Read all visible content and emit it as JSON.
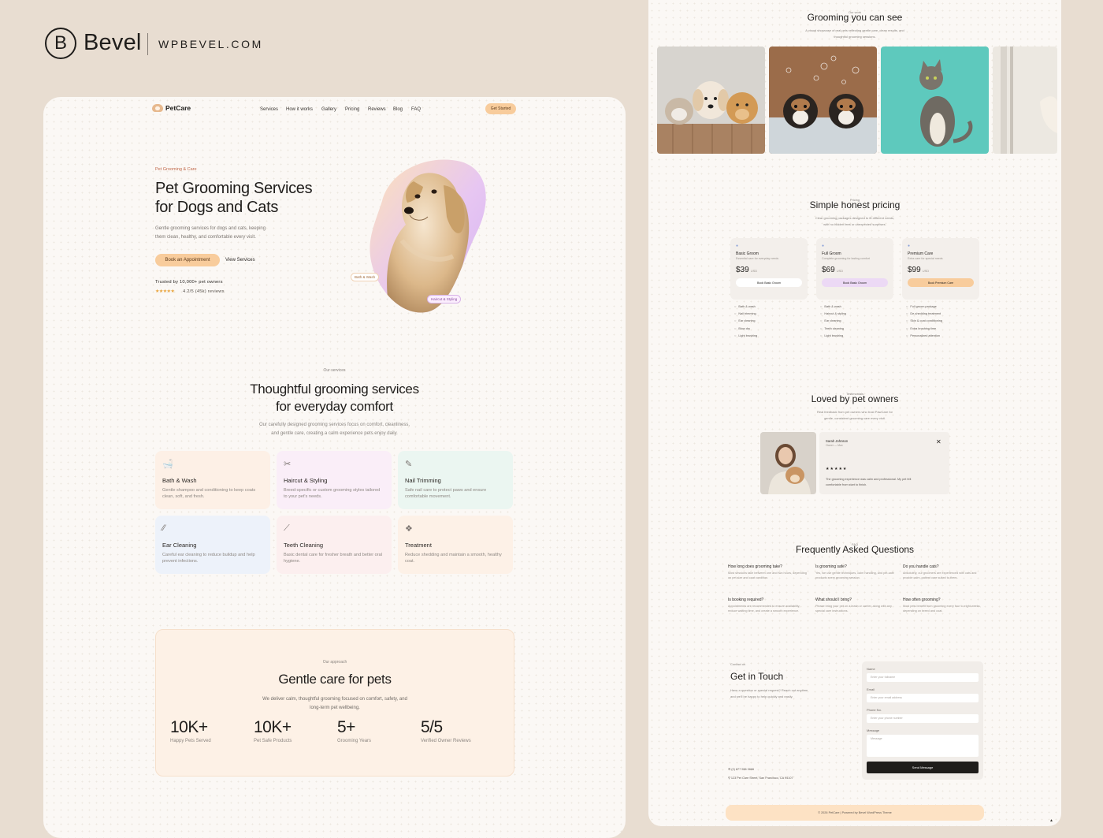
{
  "brand": {
    "logo_letter": "B",
    "name": "Bevel",
    "domain": "WPBEVEL.COM"
  },
  "site": {
    "logo_text": "PetCare",
    "nav": [
      "Services",
      "How it works",
      "Gallery",
      "Pricing",
      "Reviews",
      "Blog",
      "FAQ"
    ],
    "cta": "Get Started"
  },
  "hero": {
    "eyebrow": "Pet Grooming & Care",
    "title_line1": "Pet Grooming Services",
    "title_line2": "for Dogs and Cats",
    "desc_line1": "Gentle grooming services for dogs and cats, keeping",
    "desc_line2": "them clean, healthy, and comfortable every visit.",
    "primary_btn": "Book an Appointment",
    "secondary_btn": "View Services",
    "trust": "Trusted by 10,000+ pet owners",
    "stars": "★★★★★",
    "rating": "4.2/5 (45k) reviews",
    "tag1": "Bath & Wash",
    "tag2": "Haircut & Styling"
  },
  "services": {
    "eyebrow": "Our services",
    "title_line1": "Thoughtful grooming services",
    "title_line2": "for everyday comfort",
    "desc_line1": "Our carefully designed grooming services focus on comfort, cleanliness,",
    "desc_line2": "and gentle care, creating a calm experience pets enjoy daily.",
    "cards": [
      {
        "icon": "bathtub-icon",
        "glyph": "🛁",
        "title": "Bath & Wash",
        "desc": "Gentle shampoo and conditioning to keep coats clean, soft, and fresh.",
        "color": "#fdf0e6"
      },
      {
        "icon": "scissors-icon",
        "glyph": "✂",
        "title": "Haircut & Styling",
        "desc": "Breed-specific or custom grooming styles tailored to your pet's needs.",
        "color": "#faeef8"
      },
      {
        "icon": "nail-clipper-icon",
        "glyph": "✎",
        "title": "Nail Trimming",
        "desc": "Safe nail care to protect paws and ensure comfortable movement.",
        "color": "#ebf6f1"
      },
      {
        "icon": "cotton-swab-icon",
        "glyph": "⁄⁄",
        "title": "Ear Cleaning",
        "desc": "Careful ear cleaning to reduce buildup and help prevent infections.",
        "color": "#edf2fa"
      },
      {
        "icon": "toothbrush-icon",
        "glyph": "⟋",
        "title": "Teeth Cleaning",
        "desc": "Basic dental care for fresher breath and better oral hygiene.",
        "color": "#fcefef"
      },
      {
        "icon": "brush-icon",
        "glyph": "❖",
        "title": "Treatment",
        "desc": "Reduce shedding and maintain a smooth, healthy coat.",
        "color": "#fdf1e7"
      }
    ]
  },
  "approach": {
    "eyebrow": "Our approach",
    "title": "Gentle care for pets",
    "desc_line1": "We deliver calm, thoughtful grooming focused on comfort, safety, and",
    "desc_line2": "long-term pet wellbeing.",
    "stats": [
      {
        "value": "10K+",
        "label": "Happy Pets Served"
      },
      {
        "value": "10K+",
        "label": "Pet Safe Products"
      },
      {
        "value": "5+",
        "label": "Grooming Years"
      },
      {
        "value": "5/5",
        "label": "Verified Owner Reviews"
      }
    ]
  },
  "gallery": {
    "eyebrow": "Our work",
    "title": "Grooming you can see",
    "desc_line1": "A visual showcase of real pets reflecting gentle care, clean results, and",
    "desc_line2": "thoughtful grooming sessions."
  },
  "pricing": {
    "eyebrow": "Pricing",
    "title": "Simple honest pricing",
    "desc_line1": "Clear grooming packages designed to fit different needs,",
    "desc_line2": "with no hidden fees or unexpected surprises.",
    "plans": [
      {
        "name": "Basic Groom",
        "desc": "Essential care for everyday needs",
        "price": "$39",
        "unit": "USD",
        "button": "Book Basic Groom",
        "btn_color": "#ffffff",
        "features": [
          "Bath & wash",
          "Nail trimming",
          "Ear cleaning",
          "Blow dry",
          "Light brushing"
        ]
      },
      {
        "name": "Full Groom",
        "desc": "Complete grooming for lasting comfort",
        "price": "$69",
        "unit": "USD",
        "button": "Book Basic Groom",
        "btn_color": "#ecd9f5",
        "features": [
          "Bath & wash",
          "Haircut & styling",
          "Ear cleaning",
          "Teeth cleaning",
          "Light brushing"
        ]
      },
      {
        "name": "Premium Care",
        "desc": "Extra care for special needs",
        "price": "$99",
        "unit": "USD",
        "button": "Book Premium Care",
        "btn_color": "#f8cc9c",
        "features": [
          "Full groom package",
          "De-shedding treatment",
          "Skin & coat conditioning",
          "Extra brushing time",
          "Personalized attention"
        ]
      }
    ]
  },
  "testimonials": {
    "eyebrow": "Testimonials",
    "title": "Loved by pet owners",
    "desc_line1": "Real feedback from pet owners who trust PawCare for",
    "desc_line2": "gentle, consistent grooming care every visit.",
    "author": "Sarah Johnson",
    "role": "Owner — Max",
    "stars": "★★★★★",
    "quote_line1": "The grooming experience was calm and professional. My pet felt",
    "quote_line2": "comfortable from start to finish.",
    "close": "✕"
  },
  "faq": {
    "eyebrow": "FAQ",
    "title": "Frequently Asked Questions",
    "items": [
      {
        "q": "How long does grooming take?",
        "a": "Most sessions take between one and two hours, depending on pet size and coat condition."
      },
      {
        "q": "Is grooming safe?",
        "a": "Yes, we use gentle techniques, calm handling, and pet-safe products every grooming session."
      },
      {
        "q": "Do you handle cats?",
        "a": "Absolutely, our groomers are experienced with cats and provide calm, patient care suited to them."
      },
      {
        "q": "Is booking required?",
        "a": "Appointments are recommended to ensure availability, reduce waiting time, and create a smooth experience."
      },
      {
        "q": "What should I bring?",
        "a": "Please bring your pet on a leash or carrier, along with any special care instructions."
      },
      {
        "q": "How often grooming?",
        "a": "Most pets benefit from grooming every four to eight weeks, depending on breed and coat."
      }
    ]
  },
  "contact": {
    "eyebrow": "Contact us",
    "title": "Get in Touch",
    "desc_line1": "Have a question or special request? Reach out anytime",
    "desc_line2": "and we'll be happy to help quickly and easily.",
    "phone": "(2) 877 556 0666",
    "address": "123 Pet Care Street, San Francisco, CA 94107",
    "form": {
      "name_label": "Name",
      "name_ph": "Enter your fullname",
      "email_label": "Email",
      "email_ph": "Enter your email address",
      "phone_label": "Phone No.",
      "phone_ph": "Enter your phone number",
      "message_label": "Message",
      "message_ph": "Message",
      "submit": "Send Message"
    }
  },
  "footer": {
    "text": "© 2026 PetCare | Powered by Bevel WordPress Theme"
  },
  "colors": {
    "accent": "#f8cc9c",
    "page_bg": "#e8ddd1",
    "panel_bg": "#fbf8f5",
    "dark": "#1f1d1b"
  }
}
